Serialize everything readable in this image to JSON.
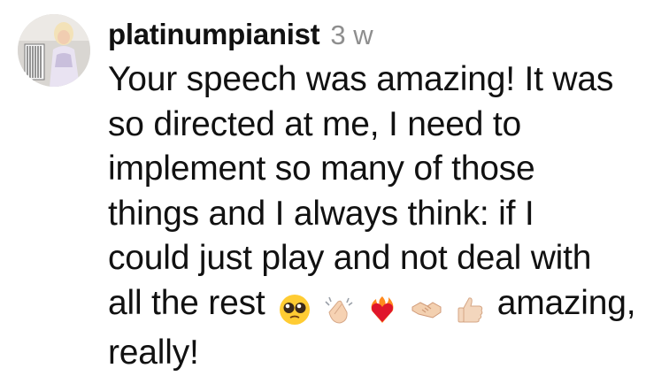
{
  "comment": {
    "username": "platinumpianist",
    "time": "3 w",
    "text_lines": [
      "Your speech was amazing! It was",
      "so directed at me, I need to",
      "implement so many of those",
      "things and I always think: if I",
      "could just play and not deal with",
      "all the rest",
      "amazing,",
      "really!"
    ],
    "emojis": [
      "pleading-face-emoji",
      "clapping-hands-emoji",
      "heart-on-fire-emoji",
      "handshake-emoji",
      "thumbs-up-emoji"
    ]
  }
}
